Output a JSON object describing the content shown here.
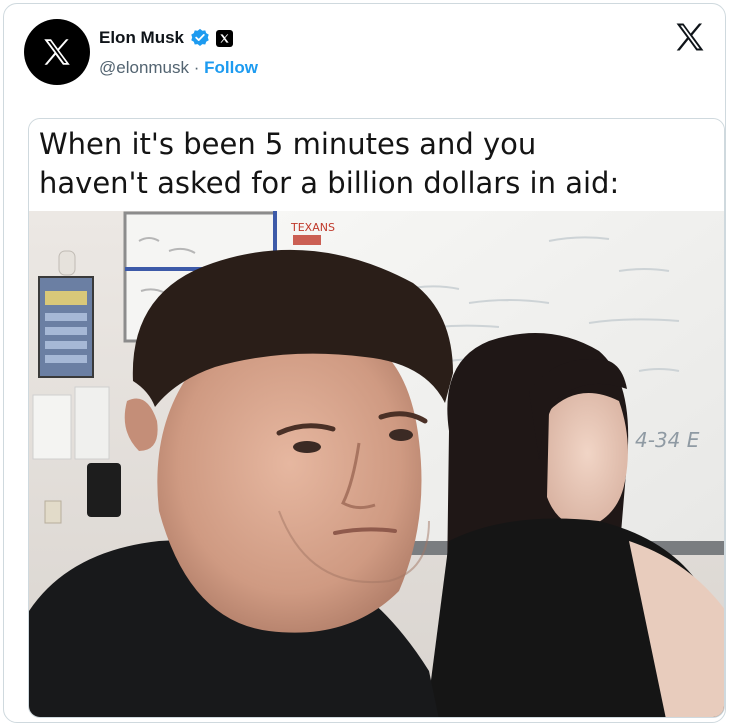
{
  "author": {
    "name": "Elon Musk",
    "handle": "@elonmusk",
    "separator": "·",
    "follow_label": "Follow",
    "avatar_icon": "x-logo-icon",
    "verified_color": "#1d9bf0"
  },
  "meme": {
    "caption_line1": "When it's been 5 minutes and you",
    "caption_line2": "haven't asked for a billion dollars in aid:",
    "whiteboard_text": "4-34 E"
  },
  "colors": {
    "accent": "#1d9bf0",
    "text": "#0f1419",
    "muted": "#536471"
  }
}
